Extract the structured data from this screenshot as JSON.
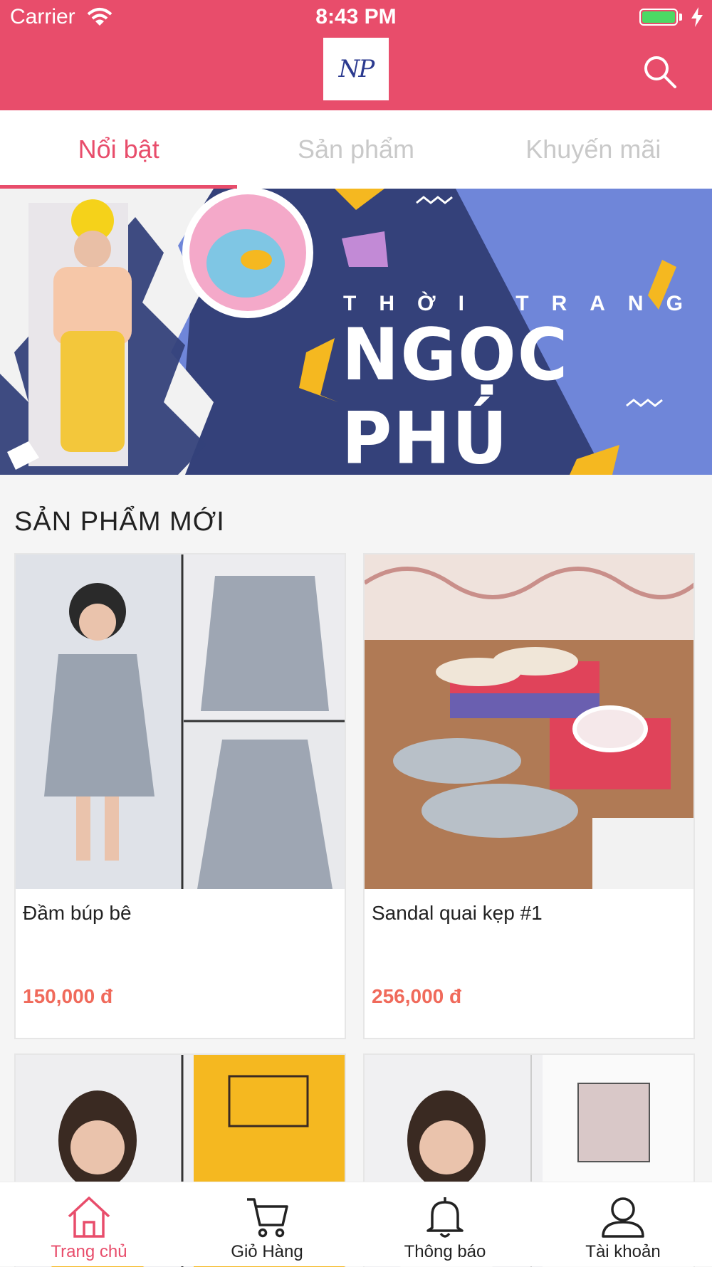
{
  "status_bar": {
    "carrier": "Carrier",
    "time": "8:43 PM"
  },
  "header": {
    "logo_text": "NP",
    "search_icon": "search-icon"
  },
  "tabs": [
    {
      "label": "Nổi bật",
      "active": true
    },
    {
      "label": "Sản phẩm",
      "active": false
    },
    {
      "label": "Khuyến mãi",
      "active": false
    }
  ],
  "banner": {
    "subtitle": "THỜI TRANG",
    "title": "NGỌC PHÚ"
  },
  "section": {
    "title": "SẢN PHẨM MỚI"
  },
  "products": [
    {
      "name": "Đầm búp bê",
      "price": "150,000 đ"
    },
    {
      "name": "Sandal quai kẹp #1",
      "price": "256,000 đ"
    },
    {
      "name": "",
      "price": ""
    },
    {
      "name": "",
      "price": ""
    }
  ],
  "bottom_nav": [
    {
      "label": "Trang chủ",
      "icon": "home-icon",
      "active": true
    },
    {
      "label": "Giỏ Hàng",
      "icon": "cart-icon",
      "active": false
    },
    {
      "label": "Thông báo",
      "icon": "bell-icon",
      "active": false
    },
    {
      "label": "Tài khoản",
      "icon": "user-icon",
      "active": false
    }
  ],
  "colors": {
    "brand": "#e84d6b",
    "price": "#f06a5b",
    "banner_navy": "#34417a",
    "banner_blue": "#6f86d9",
    "accent_yellow": "#f5b820"
  }
}
